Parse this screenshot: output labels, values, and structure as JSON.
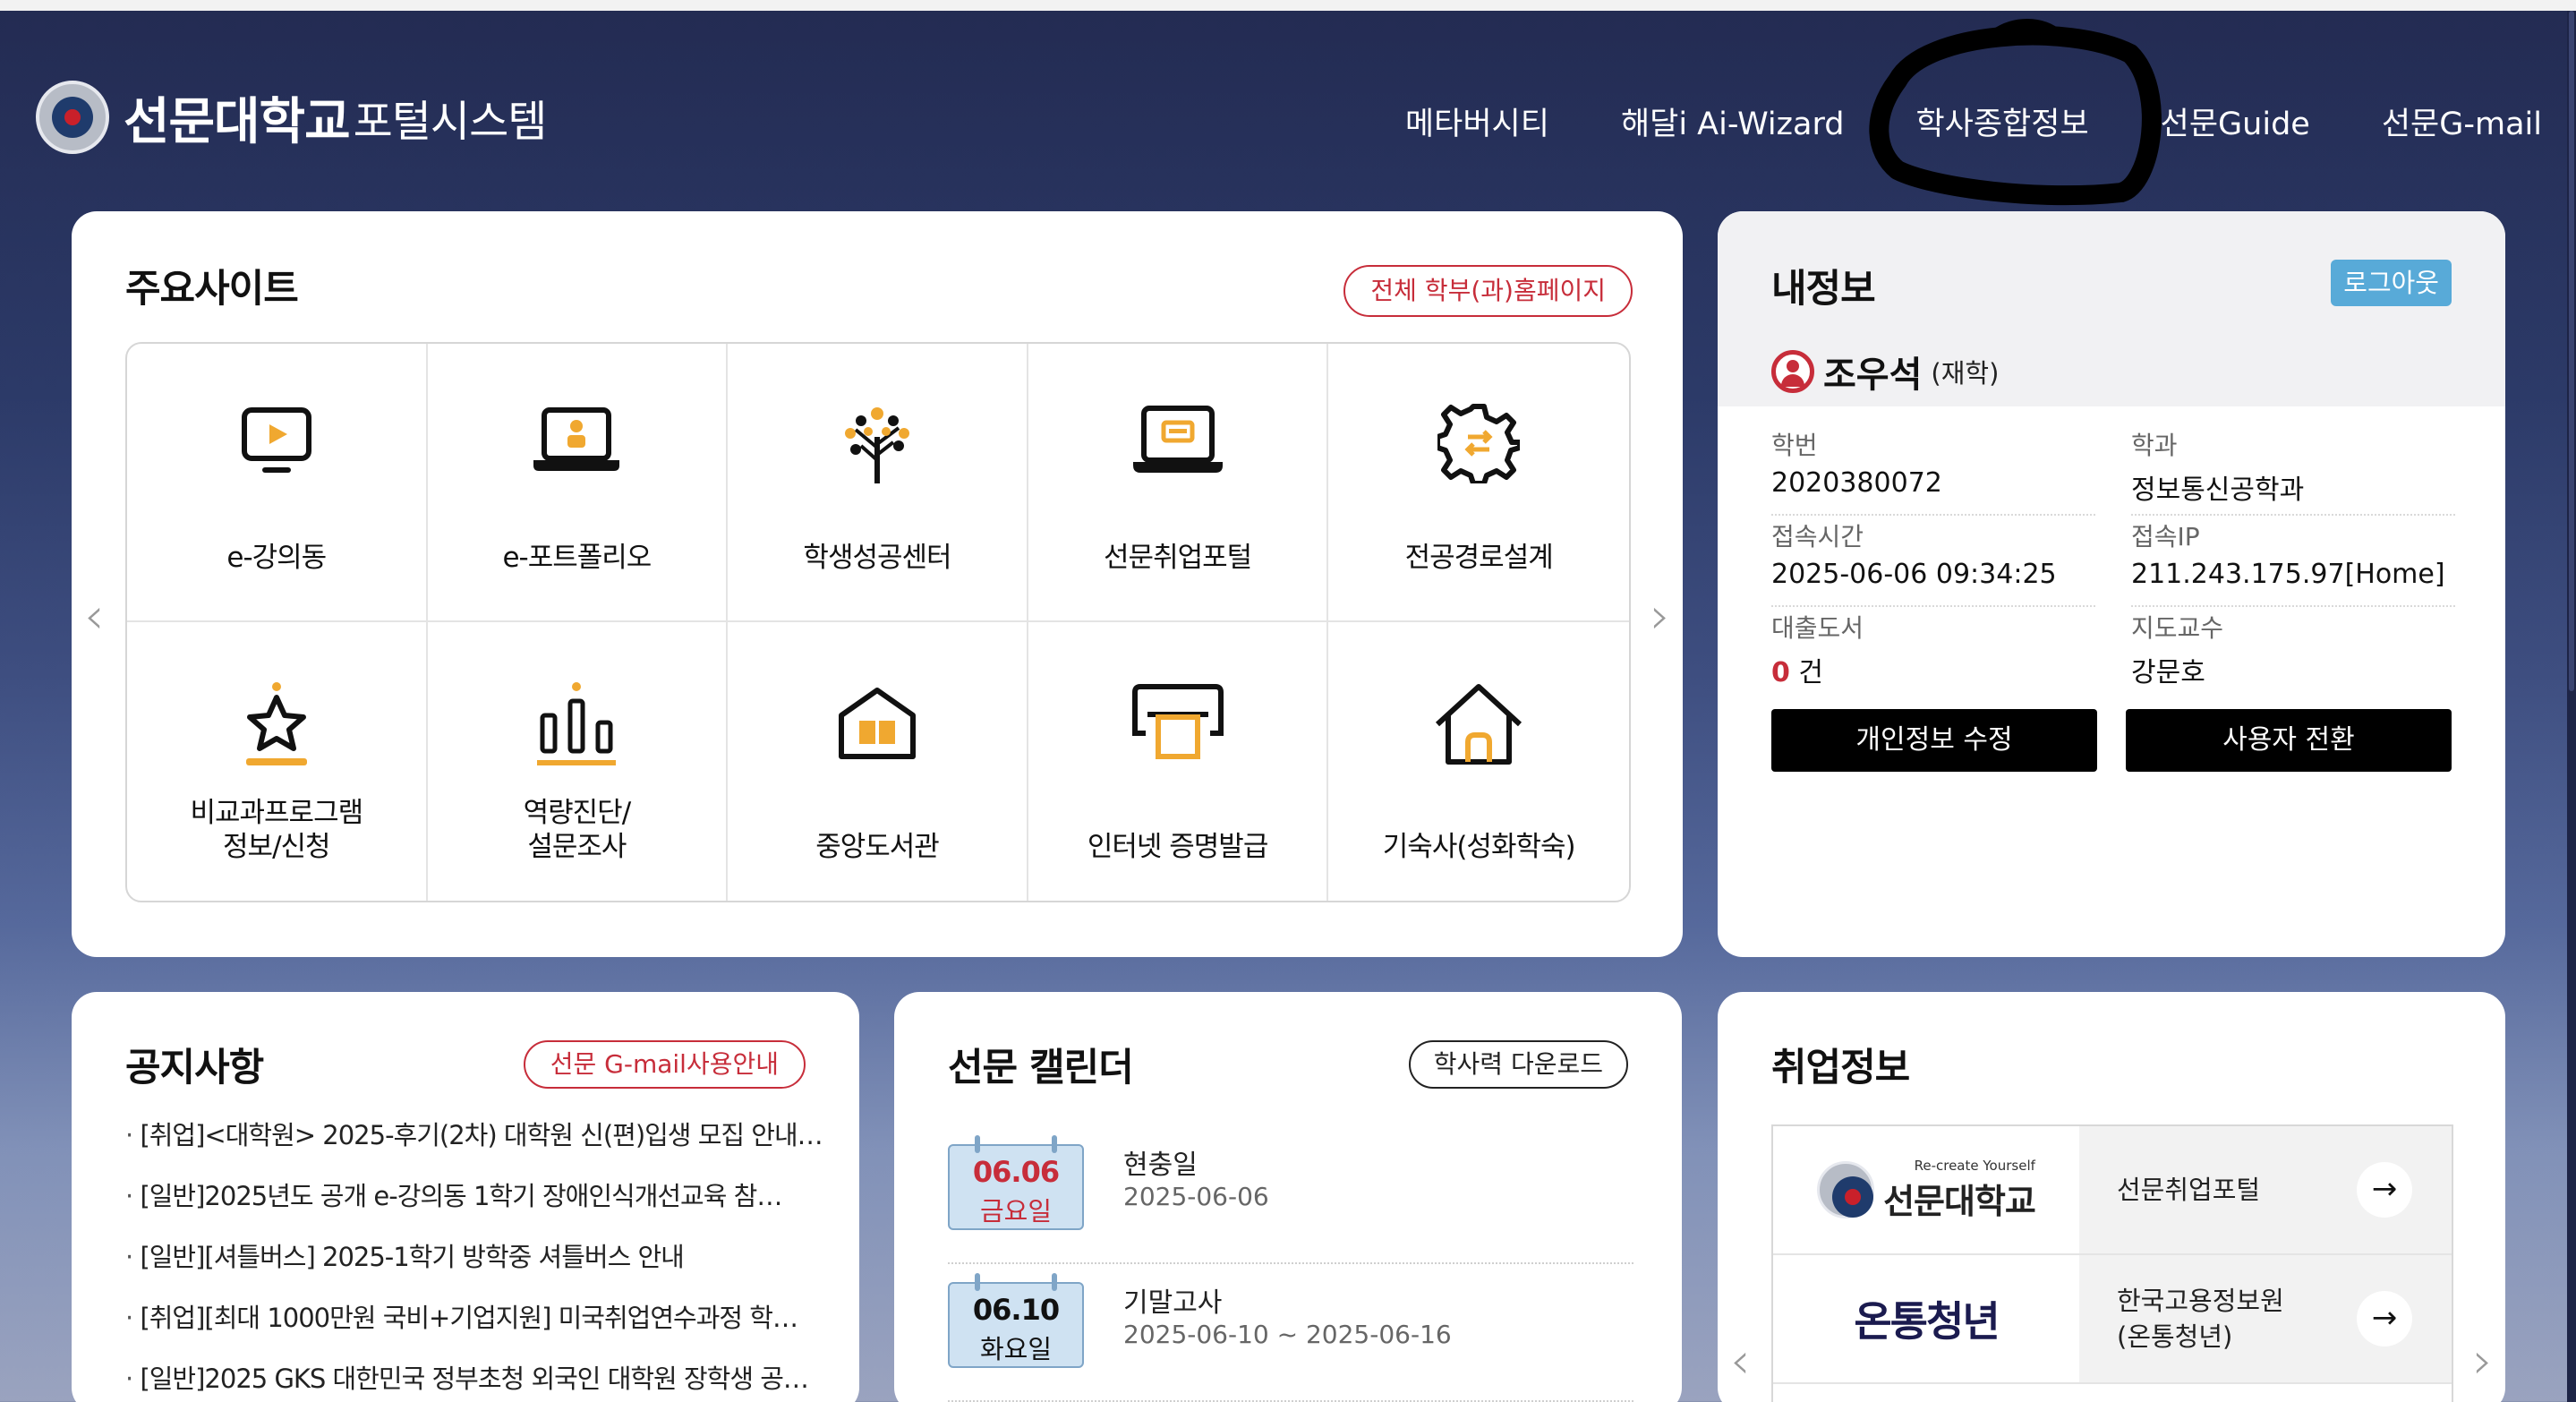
{
  "header": {
    "logo_main": "선문대학교",
    "logo_sub": "포털시스템",
    "nav": [
      "메타버시티",
      "해달i Ai-Wizard",
      "학사종합정보",
      "선문Guide",
      "선문G-mail"
    ]
  },
  "major_sites": {
    "title": "주요사이트",
    "all_link": "전체 학부(과)홈페이지",
    "items": [
      {
        "label": "e-강의동",
        "icon": "play-screen-icon"
      },
      {
        "label": "e-포트폴리오",
        "icon": "laptop-person-icon"
      },
      {
        "label": "학생성공센터",
        "icon": "tree-icon"
      },
      {
        "label": "선문취업포털",
        "icon": "laptop-icon"
      },
      {
        "label": "전공경로설계",
        "icon": "gear-icon"
      },
      {
        "label": "비교과프로그램\n정보/신청",
        "icon": "star-trophy-icon"
      },
      {
        "label": "역량진단/\n설문조사",
        "icon": "bar-chart-icon"
      },
      {
        "label": "중앙도서관",
        "icon": "library-icon"
      },
      {
        "label": "인터넷 증명발급",
        "icon": "printer-icon"
      },
      {
        "label": "기숙사(성화학숙)",
        "icon": "house-icon"
      }
    ]
  },
  "my_info": {
    "title": "내정보",
    "logout": "로그아웃",
    "name": "조우석",
    "status": "(재학)",
    "fields": {
      "student_id_label": "학번",
      "student_id": "2020380072",
      "dept_label": "학과",
      "dept": "정보통신공학과",
      "access_time_label": "접속시간",
      "access_time": "2025-06-06 09:34:25",
      "access_ip_label": "접속IP",
      "access_ip": "211.243.175.97[Home]",
      "loan_label": "대출도서",
      "loan_count": "0",
      "loan_unit": "건",
      "advisor_label": "지도교수",
      "advisor": "강문호"
    },
    "edit_button": "개인정보 수정",
    "switch_button": "사용자 전환"
  },
  "notice": {
    "title": "공지사항",
    "gmail_guide": "선문 G-mail사용안내",
    "items": [
      "[취업]<대학원> 2025-후기(2차) 대학원 신(편)입생 모집 안내…",
      "[일반]2025년도 공개 e-강의동 1학기 장애인식개선교육 참…",
      "[일반][셔틀버스] 2025-1학기 방학중 셔틀버스 안내",
      "[취업][최대 1000만원 국비+기업지원] 미국취업연수과정 학…",
      "[일반]2025 GKS 대한민국 정부초청 외국인 대학원 장학생 공…"
    ]
  },
  "calendar": {
    "title": "선문 캘린더",
    "download": "학사력 다운로드",
    "events": [
      {
        "date": "06.06",
        "weekday": "금요일",
        "title": "현충일",
        "range": "2025-06-06"
      },
      {
        "date": "06.10",
        "weekday": "화요일",
        "title": "기말고사",
        "range": "2025-06-10 ~ 2025-06-16"
      }
    ]
  },
  "jobs": {
    "title": "취업정보",
    "items": [
      {
        "logo_tagline": "Re-create Yourself",
        "logo_text": "선문대학교",
        "name": "선문취업포털"
      },
      {
        "logo_text": "온통청년",
        "name": "한국고용정보원\n(온통청년)"
      }
    ]
  },
  "colors": {
    "accent_red": "#c72d3a",
    "icon_orange": "#f0a830",
    "logout_blue": "#58aad8"
  }
}
